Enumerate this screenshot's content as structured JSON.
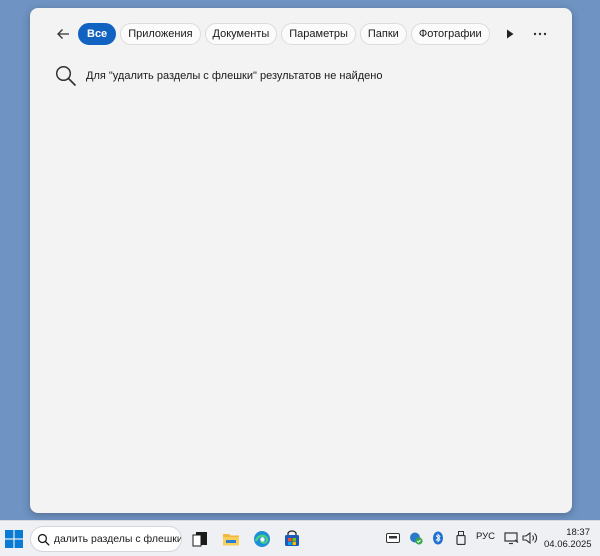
{
  "search_panel": {
    "filters": [
      {
        "label": "Все",
        "active": true
      },
      {
        "label": "Приложения",
        "active": false
      },
      {
        "label": "Документы",
        "active": false
      },
      {
        "label": "Параметры",
        "active": false
      },
      {
        "label": "Папки",
        "active": false
      },
      {
        "label": "Фотографии",
        "active": false
      }
    ],
    "no_results_message": "Для \"удалить разделы с флешки\" результатов не найдено"
  },
  "taskbar": {
    "search_value": "далить разделы с флешки",
    "pinned_apps": [
      "task-view-icon",
      "file-explorer-icon",
      "edge-icon",
      "store-icon"
    ],
    "tray_icons": [
      "keyboard-icon",
      "defender-icon",
      "bluetooth-icon",
      "usb-icon",
      "display-icon",
      "volume-icon"
    ],
    "language": "РУС",
    "time": "18:37",
    "date": "04.06.2025"
  },
  "colors": {
    "desktop": "#6f93c2",
    "panel": "#f3f3f3",
    "accent": "#1262c2"
  }
}
